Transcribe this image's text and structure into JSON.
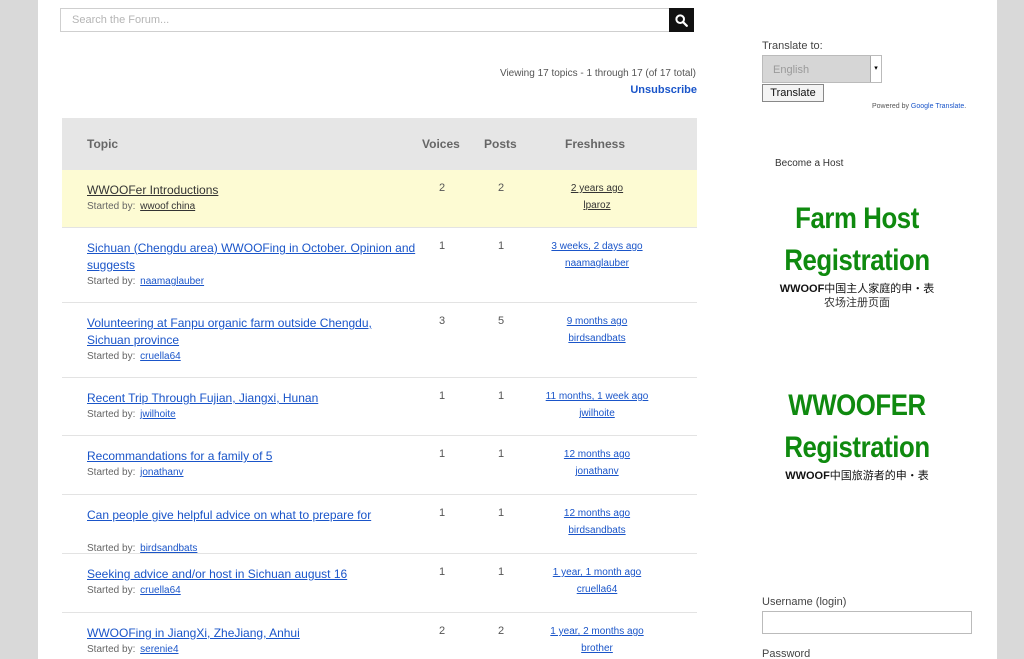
{
  "search": {
    "placeholder": "Search the Forum..."
  },
  "forum": {
    "viewing": "Viewing 17 topics - 1 through 17 (of 17 total)",
    "unsubscribe": "Unsubscribe",
    "headers": {
      "topic": "Topic",
      "voices": "Voices",
      "posts": "Posts",
      "freshness": "Freshness"
    },
    "started_by_label": "Started by:",
    "topics": [
      {
        "title": "WWOOFer Introductions",
        "starter": "wwoof china",
        "voices": "2",
        "posts": "2",
        "fresh_time": "2 years ago",
        "fresh_user": "lparoz",
        "sticky": true
      },
      {
        "title": "Sichuan (Chengdu area) WWOOFing in October. Opinion and suggests",
        "starter": "naamaglauber",
        "voices": "1",
        "posts": "1",
        "fresh_time": "3 weeks, 2 days ago",
        "fresh_user": "naamaglauber",
        "sticky": false
      },
      {
        "title": "Volunteering at Fanpu organic farm outside Chengdu, Sichuan province",
        "starter": "cruella64",
        "voices": "3",
        "posts": "5",
        "fresh_time": "9 months ago",
        "fresh_user": "birdsandbats",
        "sticky": false
      },
      {
        "title": "Recent Trip Through Fujian, Jiangxi, Hunan",
        "starter": "jwilhoite",
        "voices": "1",
        "posts": "1",
        "fresh_time": "11 months, 1 week ago",
        "fresh_user": "jwilhoite",
        "sticky": false
      },
      {
        "title": "Recommandations for a family of 5",
        "starter": "jonathanv",
        "voices": "1",
        "posts": "1",
        "fresh_time": "12 months ago",
        "fresh_user": "jonathanv",
        "sticky": false
      },
      {
        "title": "Can people give helpful advice on what to prepare for",
        "starter": "birdsandbats",
        "voices": "1",
        "posts": "1",
        "fresh_time": "12 months ago",
        "fresh_user": "birdsandbats",
        "sticky": false
      },
      {
        "title": "Seeking advice and/or host in Sichuan august 16",
        "starter": "cruella64",
        "voices": "1",
        "posts": "1",
        "fresh_time": "1 year, 1 month ago",
        "fresh_user": "cruella64",
        "sticky": false
      },
      {
        "title": "WWOOFing in JiangXi, ZheJiang, Anhui",
        "starter": "serenie4",
        "voices": "2",
        "posts": "2",
        "fresh_time": "1 year, 2 months ago",
        "fresh_user": "brother",
        "sticky": false
      }
    ]
  },
  "sidebar": {
    "translate_label": "Translate to:",
    "language": "English",
    "translate_button": "Translate",
    "powered_prefix": "Powered by",
    "powered_link": "Google Translate",
    "powered_suffix": ".",
    "host_label": "Become a Host",
    "farm_host_line1": "Farm Host",
    "farm_host_line2": "Registration",
    "farm_host_sub_brand": "WWOOF",
    "farm_host_sub": "中国主人家庭的申・表",
    "farm_host_sub2": "农场注册页面",
    "wwoofer_line1": "WWOOFER",
    "wwoofer_line2": "Registration",
    "wwoofer_sub_brand": "WWOOF",
    "wwoofer_sub": "中国旅游者的申・表",
    "username_label": "Username (login)",
    "password_label": "Password"
  },
  "colors": {
    "link": "#1a55c9",
    "promo_green": "#0f8a0f",
    "sticky_bg": "#fdfbd3",
    "header_bg": "#e6e6e6"
  }
}
